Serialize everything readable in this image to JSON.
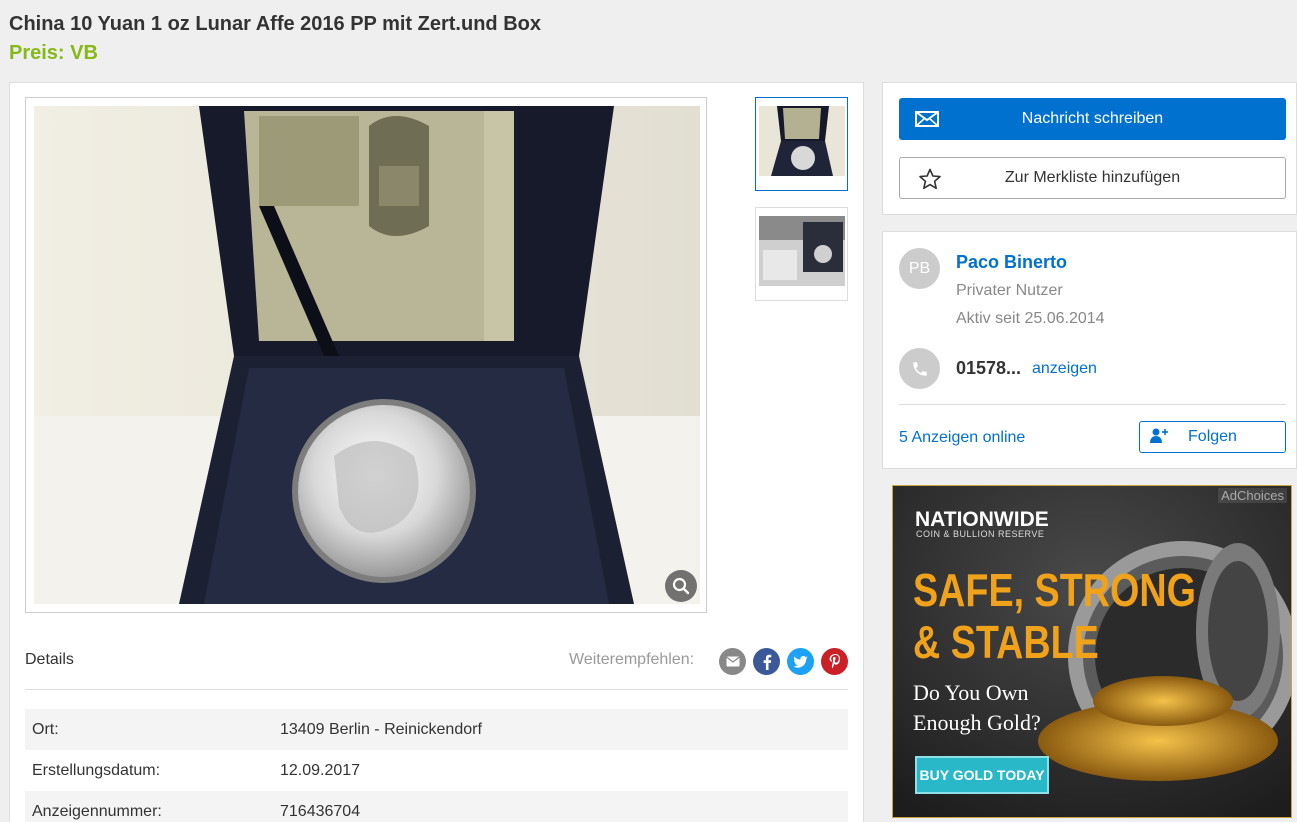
{
  "listing": {
    "title": "China 10 Yuan 1 oz Lunar Affe 2016 PP mit Zert.und Box",
    "price": "Preis: VB"
  },
  "gallery": {
    "thumbnails": [
      "Foto 1",
      "Foto 2"
    ],
    "zoom_icon": "magnifier-icon"
  },
  "details": {
    "heading": "Details",
    "share_label": "Weiterempfehlen:",
    "share_icons": [
      "email-icon",
      "facebook-icon",
      "twitter-icon",
      "pinterest-icon"
    ],
    "rows": [
      {
        "key": "Ort:",
        "value": "13409 Berlin - Reinickendorf"
      },
      {
        "key": "Erstellungsdatum:",
        "value": "12.09.2017"
      },
      {
        "key": "Anzeigennummer:",
        "value": "716436704"
      }
    ]
  },
  "actions": {
    "message_label": "Nachricht schreiben",
    "watchlist_label": "Zur Merkliste hinzufügen"
  },
  "seller": {
    "initials": "PB",
    "name": "Paco Binerto",
    "type": "Privater Nutzer",
    "active_since": "Aktiv seit 25.06.2014",
    "phone": "01578...",
    "phone_reveal": "anzeigen",
    "ads_online": "5 Anzeigen online",
    "follow_label": "Folgen"
  },
  "ad": {
    "adchoices": "AdChoices",
    "brand": "NATIONWIDE",
    "brand_sub": "COIN & BULLION RESERVE",
    "headline_1": "SAFE, STRONG",
    "headline_2": "& STABLE",
    "question_1": "Do You Own",
    "question_2": "Enough Gold?",
    "cta": "BUY GOLD TODAY"
  },
  "colors": {
    "accent": "#0071ce",
    "price": "#86b817",
    "ad_gold": "#f0a21b",
    "ad_cta": "#29b8c8"
  }
}
